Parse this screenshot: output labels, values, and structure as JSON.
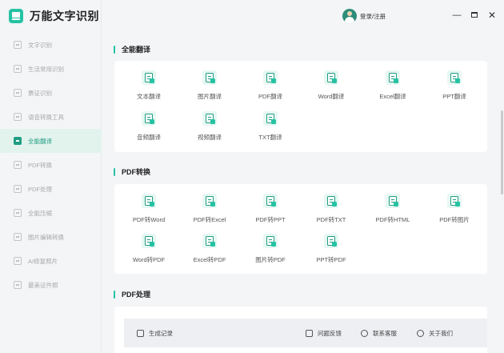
{
  "app": {
    "title": "万能文字识别"
  },
  "sidebar": {
    "items": [
      {
        "label": "文字识别",
        "icon": "scan-text-icon",
        "active": false
      },
      {
        "label": "生活常用识别",
        "icon": "scan-life-icon",
        "active": false
      },
      {
        "label": "票证识别",
        "icon": "ticket-icon",
        "active": false
      },
      {
        "label": "语音转换工具",
        "icon": "audio-tool-icon",
        "active": false
      },
      {
        "label": "全能翻译",
        "icon": "translate-icon",
        "active": true
      },
      {
        "label": "PDF转换",
        "icon": "pdf-convert-icon",
        "active": false
      },
      {
        "label": "PDF处理",
        "icon": "pdf-process-icon",
        "active": false
      },
      {
        "label": "全能压缩",
        "icon": "compress-icon",
        "active": false
      },
      {
        "label": "图片编辑转换",
        "icon": "image-edit-icon",
        "active": false
      },
      {
        "label": "AI修复照片",
        "icon": "ai-repair-icon",
        "active": false
      },
      {
        "label": "最美证件照",
        "icon": "id-photo-icon",
        "active": false
      }
    ]
  },
  "topbar": {
    "login_label": "登录/注册"
  },
  "sections": [
    {
      "title": "全能翻译",
      "tools": [
        {
          "label": "文本翻译"
        },
        {
          "label": "图片翻译"
        },
        {
          "label": "PDF翻译"
        },
        {
          "label": "Word翻译"
        },
        {
          "label": "Excel翻译"
        },
        {
          "label": "PPT翻译"
        },
        {
          "label": "音频翻译"
        },
        {
          "label": "视频翻译"
        },
        {
          "label": "TXT翻译"
        }
      ]
    },
    {
      "title": "PDF转换",
      "tools": [
        {
          "label": "PDF转Word"
        },
        {
          "label": "PDF转Excel"
        },
        {
          "label": "PDF转PPT"
        },
        {
          "label": "PDF转TXT"
        },
        {
          "label": "PDF转HTML"
        },
        {
          "label": "PDF转图片"
        },
        {
          "label": "Word转PDF"
        },
        {
          "label": "Excel转PDF"
        },
        {
          "label": "图片转PDF"
        },
        {
          "label": "PPT转PDF"
        }
      ]
    },
    {
      "title": "PDF处理",
      "tools": []
    }
  ],
  "bottombar": {
    "history_label": "生成记录",
    "feedback_label": "问题反馈",
    "service_label": "联系客服",
    "about_label": "关于我们"
  },
  "colors": {
    "accent": "#26c2a3",
    "accent_dark": "#1f9c82",
    "active_bg": "#e2f3ee"
  }
}
